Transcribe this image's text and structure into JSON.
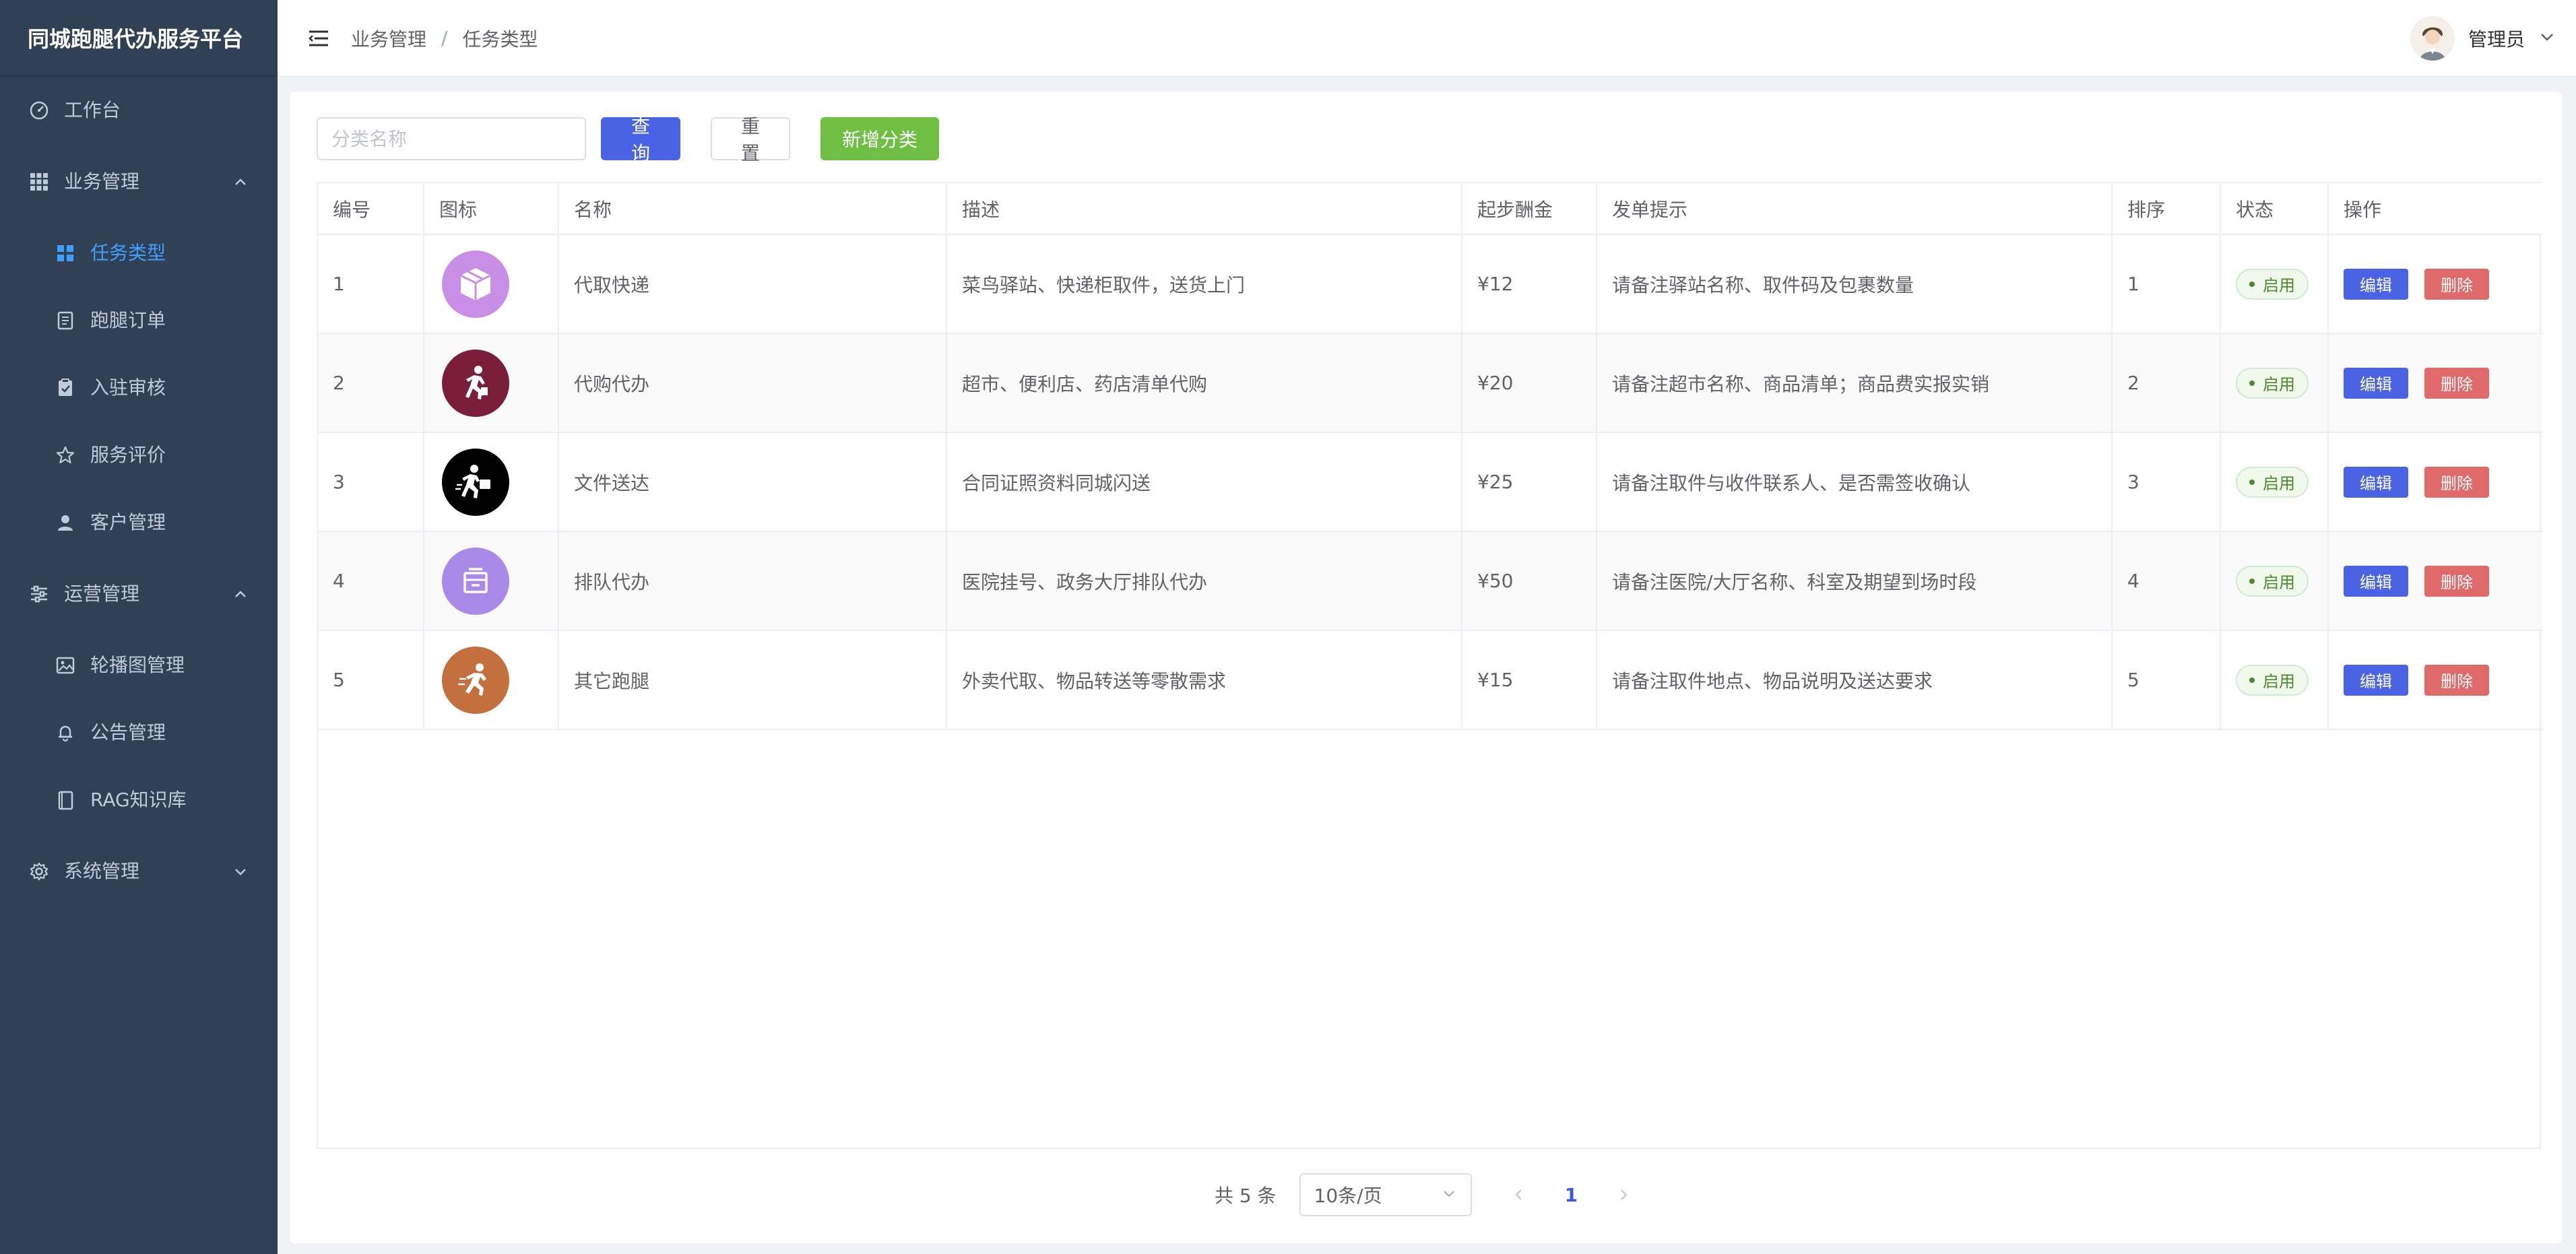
{
  "app": {
    "title": "同城跑腿代办服务平台"
  },
  "sidebar": {
    "items": [
      {
        "label": "工作台",
        "icon": "dashboard-icon"
      },
      {
        "label": "业务管理",
        "icon": "grid-icon"
      },
      {
        "label": "任务类型",
        "icon": "category-icon",
        "active": true
      },
      {
        "label": "跑腿订单",
        "icon": "document-icon"
      },
      {
        "label": "入驻审核",
        "icon": "clipboard-check-icon"
      },
      {
        "label": "服务评价",
        "icon": "star-icon"
      },
      {
        "label": "客户管理",
        "icon": "user-icon"
      },
      {
        "label": "运营管理",
        "icon": "sliders-icon"
      },
      {
        "label": "轮播图管理",
        "icon": "image-icon"
      },
      {
        "label": "公告管理",
        "icon": "bell-icon"
      },
      {
        "label": "RAG知识库",
        "icon": "notebook-icon"
      },
      {
        "label": "系统管理",
        "icon": "gear-icon"
      }
    ]
  },
  "header": {
    "breadcrumb": [
      "业务管理",
      "任务类型"
    ],
    "separator": "/",
    "user": "管理员"
  },
  "toolbar": {
    "search_placeholder": "分类名称",
    "query_label": "查询",
    "reset_label": "重置",
    "add_label": "新增分类"
  },
  "table": {
    "columns": [
      "编号",
      "图标",
      "名称",
      "描述",
      "起步酬金",
      "发单提示",
      "排序",
      "状态",
      "操作"
    ],
    "rows": [
      {
        "id": "1",
        "icon": "package-icon",
        "icon_color": "#c98ee6",
        "name": "代取快递",
        "desc": "菜鸟驿站、快递柜取件，送货上门",
        "fee": "¥12",
        "tip": "请备注驿站名称、取件码及包裹数量",
        "sort": "1",
        "status": "启用"
      },
      {
        "id": "2",
        "icon": "runner-icon",
        "icon_color": "#7a1e3c",
        "name": "代购代办",
        "desc": "超市、便利店、药店清单代购",
        "fee": "¥20",
        "tip": "请备注超市名称、商品清单；商品费实报实销",
        "sort": "2",
        "status": "启用"
      },
      {
        "id": "3",
        "icon": "courier-icon",
        "icon_color": "#000000",
        "name": "文件送达",
        "desc": "合同证照资料同城闪送",
        "fee": "¥25",
        "tip": "请备注取件与收件联系人、是否需签收确认",
        "sort": "3",
        "status": "启用"
      },
      {
        "id": "4",
        "icon": "queue-ticket-icon",
        "icon_color": "#a98ae8",
        "name": "排队代办",
        "desc": "医院挂号、政务大厅排队代办",
        "fee": "¥50",
        "tip": "请备注医院/大厅名称、科室及期望到场时段",
        "sort": "4",
        "status": "启用"
      },
      {
        "id": "5",
        "icon": "running-man-icon",
        "icon_color": "#c4703e",
        "name": "其它跑腿",
        "desc": "外卖代取、物品转送等零散需求",
        "fee": "¥15",
        "tip": "请备注取件地点、物品说明及送达要求",
        "sort": "5",
        "status": "启用"
      }
    ],
    "edit_label": "编辑",
    "delete_label": "删除"
  },
  "pagination": {
    "total": "共 5 条",
    "page_size": "10条/页",
    "current_page": "1"
  },
  "colors": {
    "sidebar_bg": "#304156",
    "active": "#409eff",
    "primary": "#4a63e4",
    "success": "#6fbf44",
    "danger": "#e06a6a"
  }
}
